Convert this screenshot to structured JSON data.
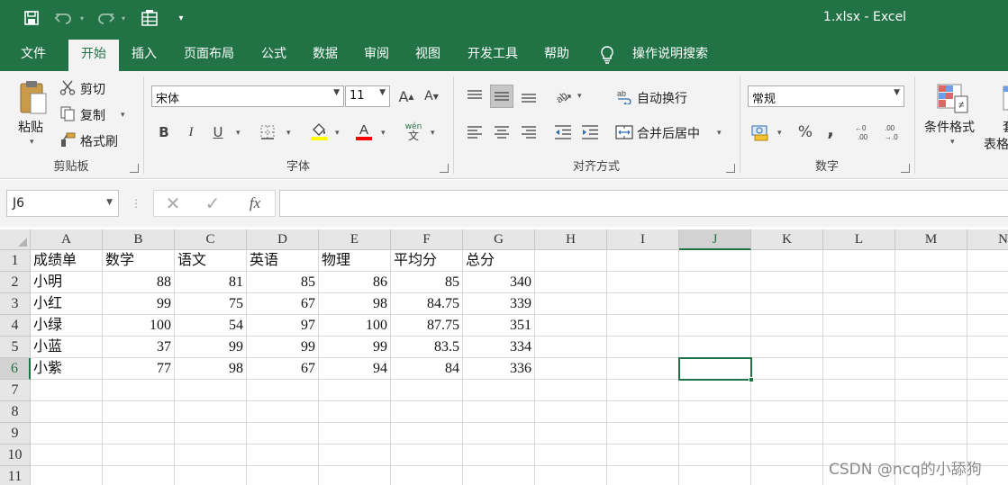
{
  "window": {
    "title": "1.xlsx  -  Excel"
  },
  "quick_access": {
    "save": "save-icon",
    "undo": "undo-icon",
    "redo": "redo-icon",
    "form": "form-icon",
    "customize": "▾"
  },
  "tabs": [
    {
      "label": "文件"
    },
    {
      "label": "开始"
    },
    {
      "label": "插入"
    },
    {
      "label": "页面布局"
    },
    {
      "label": "公式"
    },
    {
      "label": "数据"
    },
    {
      "label": "审阅"
    },
    {
      "label": "视图"
    },
    {
      "label": "开发工具"
    },
    {
      "label": "帮助"
    }
  ],
  "active_tab": "开始",
  "tell_me": "操作说明搜索",
  "ribbon": {
    "clipboard": {
      "paste": "粘贴",
      "cut": "剪切",
      "copy": "复制",
      "format_painter": "格式刷",
      "label": "剪贴板"
    },
    "font": {
      "name": "宋体",
      "size": "11",
      "bold": "B",
      "italic": "I",
      "underline": "U",
      "label": "字体",
      "wen": "wén",
      "wen2": "文"
    },
    "alignment": {
      "wrap": "自动换行",
      "merge": "合并后居中",
      "label": "对齐方式"
    },
    "number": {
      "format": "常规",
      "percent": "%",
      "comma": ",",
      "inc": ".00",
      "label": "数字"
    },
    "styles": {
      "conditional": "条件格式",
      "table_partial": "套",
      "table_partial2": "表格"
    }
  },
  "formula_bar": {
    "name_box": "J6",
    "fx": "fx",
    "content": ""
  },
  "sheet": {
    "columns": [
      "A",
      "B",
      "C",
      "D",
      "E",
      "F",
      "G",
      "H",
      "I",
      "J",
      "K",
      "L",
      "M",
      "N"
    ],
    "selected_column": "J",
    "selected_row": "6",
    "rows": [
      {
        "num": "1",
        "cells": [
          "成绩单",
          "数学",
          "语文",
          "英语",
          "物理",
          "平均分",
          "总分"
        ]
      },
      {
        "num": "2",
        "cells": [
          "小明",
          "88",
          "81",
          "85",
          "86",
          "85",
          "340"
        ]
      },
      {
        "num": "3",
        "cells": [
          "小红",
          "99",
          "75",
          "67",
          "98",
          "84.75",
          "339"
        ]
      },
      {
        "num": "4",
        "cells": [
          "小绿",
          "100",
          "54",
          "97",
          "100",
          "87.75",
          "351"
        ]
      },
      {
        "num": "5",
        "cells": [
          "小蓝",
          "37",
          "99",
          "99",
          "99",
          "83.5",
          "334"
        ]
      },
      {
        "num": "6",
        "cells": [
          "小紫",
          "77",
          "98",
          "67",
          "94",
          "84",
          "336"
        ]
      },
      {
        "num": "7",
        "cells": []
      },
      {
        "num": "8",
        "cells": []
      },
      {
        "num": "9",
        "cells": []
      },
      {
        "num": "10",
        "cells": []
      },
      {
        "num": "11",
        "cells": []
      }
    ]
  },
  "watermark": "CSDN @ncq的小舔狗",
  "colors": {
    "excel_green": "#217346",
    "ribbon_bg": "#f3f3f3",
    "fill_yellow": "#ffff00",
    "font_red": "#ff0000"
  }
}
